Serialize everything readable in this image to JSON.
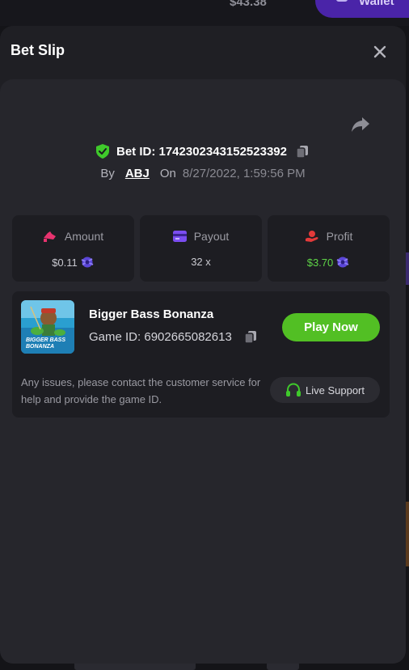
{
  "background": {
    "balance": "$43.38",
    "wallet_button_label": "Wallet"
  },
  "modal": {
    "title": "Bet Slip",
    "bet": {
      "id_label": "Bet ID:",
      "id_value": "174230234315252339 2",
      "id_text": "Bet ID: 1742302343152523392",
      "by_label": "By",
      "user": "ABJ",
      "on_label": "On",
      "date": "8/27/2022, 1:59:56 PM"
    },
    "stats": [
      {
        "label": "Amount",
        "value": "$0.11",
        "icon": "wallet-hand-icon",
        "accent": "#e8336f"
      },
      {
        "label": "Payout",
        "value": "32 x",
        "icon": "card-icon",
        "accent": "#7b4df0"
      },
      {
        "label": "Profit",
        "value": "$3.70",
        "icon": "coin-hand-icon",
        "accent": "#e33a3a"
      }
    ],
    "game": {
      "name": "Bigger Bass Bonanza",
      "id_text": "Game ID: 6902665082613",
      "thumb_text_line1": "BIGGER BASS",
      "thumb_text_line2": "BONANZA",
      "play_label": "Play Now",
      "help_text": "Any issues, please contact the customer service for help and provide the game ID.",
      "support_label": "Live Support"
    }
  },
  "colors": {
    "play_button": "#52bf24",
    "profit_value": "#5ed447",
    "verified_shield": "#3fc92b",
    "modal_bg": "#1f1f24",
    "content_bg": "#26262c",
    "card_bg": "#1d1d22"
  }
}
